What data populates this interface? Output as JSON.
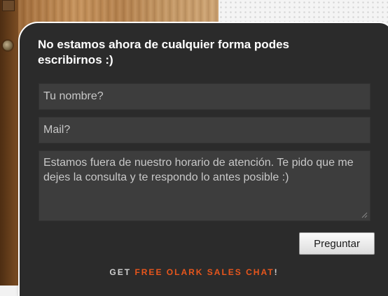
{
  "panel": {
    "title": "No estamos ahora de cualquier forma podes escribirnos :)"
  },
  "form": {
    "name_placeholder": "Tu nombre?",
    "email_placeholder": "Mail?",
    "message_value": "Estamos fuera de nuestro horario de atención. Te pido que me dejes la consulta y te respondo lo antes posible :)",
    "submit_label": "Preguntar"
  },
  "footer": {
    "prefix": "GET ",
    "link": "FREE OLARK SALES CHAT",
    "suffix": "!"
  },
  "colors": {
    "panel_bg": "#2b2b2b",
    "field_bg": "#3d3d3d",
    "accent": "#e8561c"
  }
}
